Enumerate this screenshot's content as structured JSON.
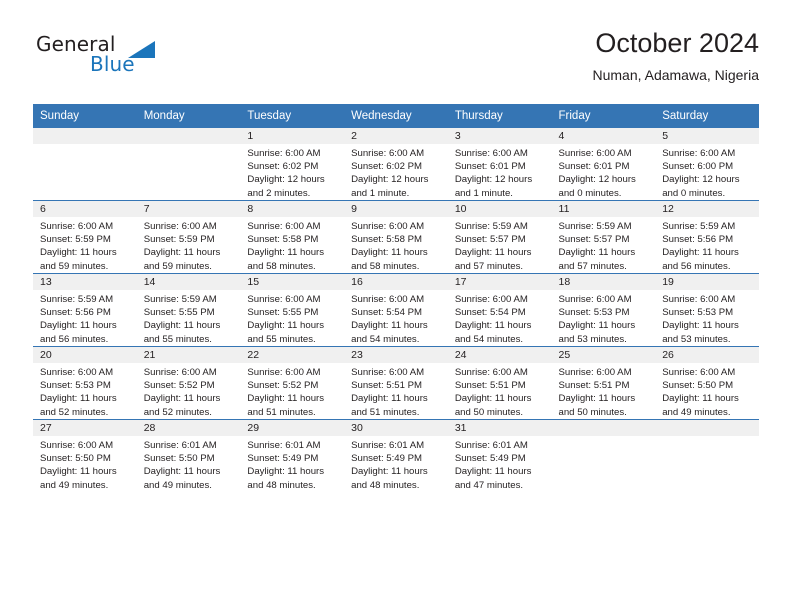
{
  "brand": {
    "name_part1": "General",
    "name_part2": "Blue",
    "triangle_color": "#1b75bb",
    "text_color": "#231f20"
  },
  "header": {
    "month_title": "October 2024",
    "location": "Numan, Adamawa, Nigeria"
  },
  "theme": {
    "header_row_bg": "#3575b4",
    "header_row_text": "#ffffff",
    "daynum_band_bg": "#f0f0f0",
    "cell_bg": "#ffffff",
    "grid_line": "#3575b4",
    "body_text": "#231f20"
  },
  "calendar": {
    "weekday_headers": [
      "Sunday",
      "Monday",
      "Tuesday",
      "Wednesday",
      "Thursday",
      "Friday",
      "Saturday"
    ],
    "weeks": [
      [
        {
          "day": "",
          "lines": []
        },
        {
          "day": "",
          "lines": []
        },
        {
          "day": "1",
          "lines": [
            "Sunrise: 6:00 AM",
            "Sunset: 6:02 PM",
            "Daylight: 12 hours",
            "and 2 minutes."
          ]
        },
        {
          "day": "2",
          "lines": [
            "Sunrise: 6:00 AM",
            "Sunset: 6:02 PM",
            "Daylight: 12 hours",
            "and 1 minute."
          ]
        },
        {
          "day": "3",
          "lines": [
            "Sunrise: 6:00 AM",
            "Sunset: 6:01 PM",
            "Daylight: 12 hours",
            "and 1 minute."
          ]
        },
        {
          "day": "4",
          "lines": [
            "Sunrise: 6:00 AM",
            "Sunset: 6:01 PM",
            "Daylight: 12 hours",
            "and 0 minutes."
          ]
        },
        {
          "day": "5",
          "lines": [
            "Sunrise: 6:00 AM",
            "Sunset: 6:00 PM",
            "Daylight: 12 hours",
            "and 0 minutes."
          ]
        }
      ],
      [
        {
          "day": "6",
          "lines": [
            "Sunrise: 6:00 AM",
            "Sunset: 5:59 PM",
            "Daylight: 11 hours",
            "and 59 minutes."
          ]
        },
        {
          "day": "7",
          "lines": [
            "Sunrise: 6:00 AM",
            "Sunset: 5:59 PM",
            "Daylight: 11 hours",
            "and 59 minutes."
          ]
        },
        {
          "day": "8",
          "lines": [
            "Sunrise: 6:00 AM",
            "Sunset: 5:58 PM",
            "Daylight: 11 hours",
            "and 58 minutes."
          ]
        },
        {
          "day": "9",
          "lines": [
            "Sunrise: 6:00 AM",
            "Sunset: 5:58 PM",
            "Daylight: 11 hours",
            "and 58 minutes."
          ]
        },
        {
          "day": "10",
          "lines": [
            "Sunrise: 5:59 AM",
            "Sunset: 5:57 PM",
            "Daylight: 11 hours",
            "and 57 minutes."
          ]
        },
        {
          "day": "11",
          "lines": [
            "Sunrise: 5:59 AM",
            "Sunset: 5:57 PM",
            "Daylight: 11 hours",
            "and 57 minutes."
          ]
        },
        {
          "day": "12",
          "lines": [
            "Sunrise: 5:59 AM",
            "Sunset: 5:56 PM",
            "Daylight: 11 hours",
            "and 56 minutes."
          ]
        }
      ],
      [
        {
          "day": "13",
          "lines": [
            "Sunrise: 5:59 AM",
            "Sunset: 5:56 PM",
            "Daylight: 11 hours",
            "and 56 minutes."
          ]
        },
        {
          "day": "14",
          "lines": [
            "Sunrise: 5:59 AM",
            "Sunset: 5:55 PM",
            "Daylight: 11 hours",
            "and 55 minutes."
          ]
        },
        {
          "day": "15",
          "lines": [
            "Sunrise: 6:00 AM",
            "Sunset: 5:55 PM",
            "Daylight: 11 hours",
            "and 55 minutes."
          ]
        },
        {
          "day": "16",
          "lines": [
            "Sunrise: 6:00 AM",
            "Sunset: 5:54 PM",
            "Daylight: 11 hours",
            "and 54 minutes."
          ]
        },
        {
          "day": "17",
          "lines": [
            "Sunrise: 6:00 AM",
            "Sunset: 5:54 PM",
            "Daylight: 11 hours",
            "and 54 minutes."
          ]
        },
        {
          "day": "18",
          "lines": [
            "Sunrise: 6:00 AM",
            "Sunset: 5:53 PM",
            "Daylight: 11 hours",
            "and 53 minutes."
          ]
        },
        {
          "day": "19",
          "lines": [
            "Sunrise: 6:00 AM",
            "Sunset: 5:53 PM",
            "Daylight: 11 hours",
            "and 53 minutes."
          ]
        }
      ],
      [
        {
          "day": "20",
          "lines": [
            "Sunrise: 6:00 AM",
            "Sunset: 5:53 PM",
            "Daylight: 11 hours",
            "and 52 minutes."
          ]
        },
        {
          "day": "21",
          "lines": [
            "Sunrise: 6:00 AM",
            "Sunset: 5:52 PM",
            "Daylight: 11 hours",
            "and 52 minutes."
          ]
        },
        {
          "day": "22",
          "lines": [
            "Sunrise: 6:00 AM",
            "Sunset: 5:52 PM",
            "Daylight: 11 hours",
            "and 51 minutes."
          ]
        },
        {
          "day": "23",
          "lines": [
            "Sunrise: 6:00 AM",
            "Sunset: 5:51 PM",
            "Daylight: 11 hours",
            "and 51 minutes."
          ]
        },
        {
          "day": "24",
          "lines": [
            "Sunrise: 6:00 AM",
            "Sunset: 5:51 PM",
            "Daylight: 11 hours",
            "and 50 minutes."
          ]
        },
        {
          "day": "25",
          "lines": [
            "Sunrise: 6:00 AM",
            "Sunset: 5:51 PM",
            "Daylight: 11 hours",
            "and 50 minutes."
          ]
        },
        {
          "day": "26",
          "lines": [
            "Sunrise: 6:00 AM",
            "Sunset: 5:50 PM",
            "Daylight: 11 hours",
            "and 49 minutes."
          ]
        }
      ],
      [
        {
          "day": "27",
          "lines": [
            "Sunrise: 6:00 AM",
            "Sunset: 5:50 PM",
            "Daylight: 11 hours",
            "and 49 minutes."
          ]
        },
        {
          "day": "28",
          "lines": [
            "Sunrise: 6:01 AM",
            "Sunset: 5:50 PM",
            "Daylight: 11 hours",
            "and 49 minutes."
          ]
        },
        {
          "day": "29",
          "lines": [
            "Sunrise: 6:01 AM",
            "Sunset: 5:49 PM",
            "Daylight: 11 hours",
            "and 48 minutes."
          ]
        },
        {
          "day": "30",
          "lines": [
            "Sunrise: 6:01 AM",
            "Sunset: 5:49 PM",
            "Daylight: 11 hours",
            "and 48 minutes."
          ]
        },
        {
          "day": "31",
          "lines": [
            "Sunrise: 6:01 AM",
            "Sunset: 5:49 PM",
            "Daylight: 11 hours",
            "and 47 minutes."
          ]
        },
        {
          "day": "",
          "lines": []
        },
        {
          "day": "",
          "lines": []
        }
      ]
    ]
  }
}
